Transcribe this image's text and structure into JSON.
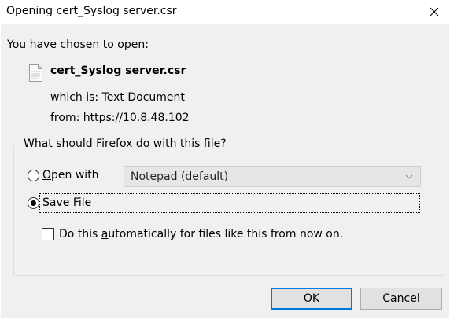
{
  "window": {
    "title": "Opening cert_Syslog server.csr",
    "close_glyph": "×"
  },
  "dialog": {
    "chosen_label": "You have chosen to open:",
    "file": {
      "icon": "text-document-icon",
      "name": "cert_Syslog server.csr",
      "type_label": "which is:",
      "type_value": "Text Document",
      "from_label": "from:",
      "from_value": "https://10.8.48.102"
    },
    "action_group": {
      "legend": "What should Firefox do with this file?",
      "open_with": {
        "label_underlined": "O",
        "label_rest": "pen with",
        "selected": false
      },
      "app_select": {
        "value": "Notepad (default)"
      },
      "save_file": {
        "label_underlined": "S",
        "label_rest": "ave File",
        "selected": true
      },
      "auto_checkbox": {
        "label_before": "Do this ",
        "label_underlined": "a",
        "label_after": "utomatically for files like this from now on.",
        "checked": false
      }
    },
    "buttons": {
      "ok": "OK",
      "cancel": "Cancel"
    }
  },
  "colors": {
    "titlebar_bg": "#ffffff",
    "body_bg": "#f0f0f0",
    "focus_accent": "#0078d7",
    "group_border": "#dcdcdc",
    "select_bg": "#e6e6e6"
  }
}
